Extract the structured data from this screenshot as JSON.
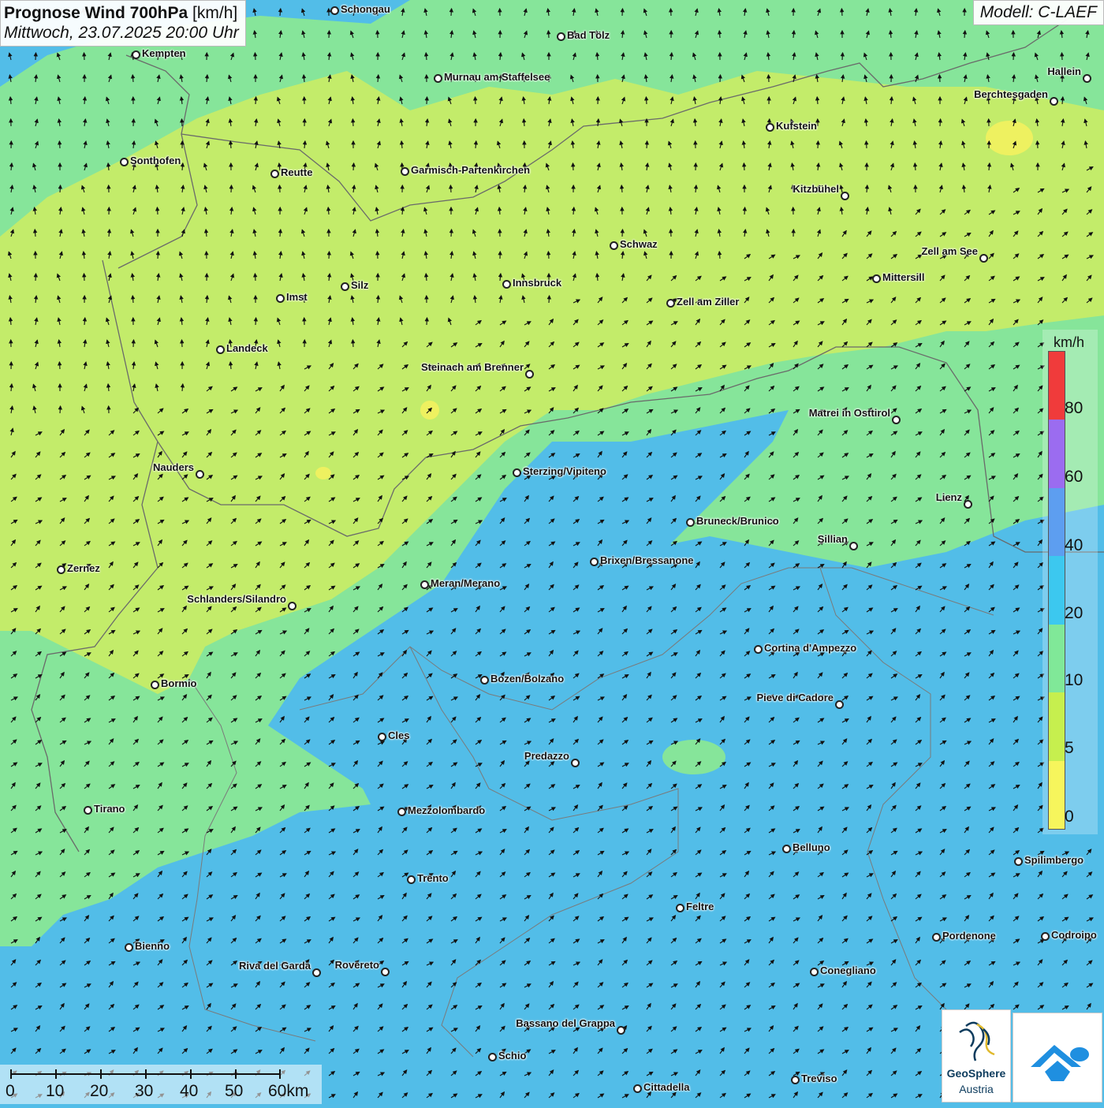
{
  "title": {
    "main": "Prognose Wind 700hPa",
    "unit": "[km/h]",
    "datetime": "Mittwoch, 23.07.2025 20:00 Uhr"
  },
  "model": "Modell: C-LAEF",
  "legend": {
    "unit": "km/h",
    "labels": [
      "80",
      "60",
      "40",
      "20",
      "10",
      "5",
      "0"
    ],
    "colors": [
      "#f03b3b",
      "#9b6cf0",
      "#5d9ef0",
      "#3cc8ef",
      "#80e898",
      "#c6ef4e",
      "#f6f55c"
    ]
  },
  "scale": {
    "labels": [
      "0",
      "10",
      "20",
      "30",
      "40",
      "50",
      "60km"
    ]
  },
  "logo": {
    "name": "GeoSphere",
    "country": "Austria"
  },
  "cities": [
    {
      "name": "Schongau"
    },
    {
      "name": "Kempten"
    },
    {
      "name": "Bad Tölz"
    },
    {
      "name": "Murnau am Staffelsee"
    },
    {
      "name": "Hallein"
    },
    {
      "name": "Berchtesgaden"
    },
    {
      "name": "Kufstein"
    },
    {
      "name": "Sonthofen"
    },
    {
      "name": "Reutte"
    },
    {
      "name": "Garmisch-Partenkirchen"
    },
    {
      "name": "Kitzbühel"
    },
    {
      "name": "Schwaz"
    },
    {
      "name": "Zell am See"
    },
    {
      "name": "Mittersill"
    },
    {
      "name": "Innsbruck"
    },
    {
      "name": "Imst"
    },
    {
      "name": "Silz"
    },
    {
      "name": "Zell am Ziller"
    },
    {
      "name": "Landeck"
    },
    {
      "name": "Steinach am Brenner"
    },
    {
      "name": "Matrei in Osttirol"
    },
    {
      "name": "Nauders"
    },
    {
      "name": "Sterzing/Vipiteno"
    },
    {
      "name": "Lienz"
    },
    {
      "name": "Bruneck/Brunico"
    },
    {
      "name": "Sillian"
    },
    {
      "name": "Brixen/Bressanone"
    },
    {
      "name": "Zernez"
    },
    {
      "name": "Meran/Merano"
    },
    {
      "name": "Schlanders/Silandro"
    },
    {
      "name": "Cortina d'Ampezzo"
    },
    {
      "name": "Bozen/Bolzano"
    },
    {
      "name": "Bormio"
    },
    {
      "name": "Pieve di Cadore"
    },
    {
      "name": "Cles"
    },
    {
      "name": "Predazzo"
    },
    {
      "name": "Tirano"
    },
    {
      "name": "Mezzolombardo"
    },
    {
      "name": "Belluno"
    },
    {
      "name": "Spilimbergo"
    },
    {
      "name": "Trento"
    },
    {
      "name": "Feltre"
    },
    {
      "name": "Pordenone"
    },
    {
      "name": "Codroipo"
    },
    {
      "name": "Bienno"
    },
    {
      "name": "Riva del Garda"
    },
    {
      "name": "Rovereto"
    },
    {
      "name": "Conegliano"
    },
    {
      "name": "Bassano del Grappa"
    },
    {
      "name": "Schio"
    },
    {
      "name": "Treviso"
    },
    {
      "name": "Cittadella"
    }
  ]
}
